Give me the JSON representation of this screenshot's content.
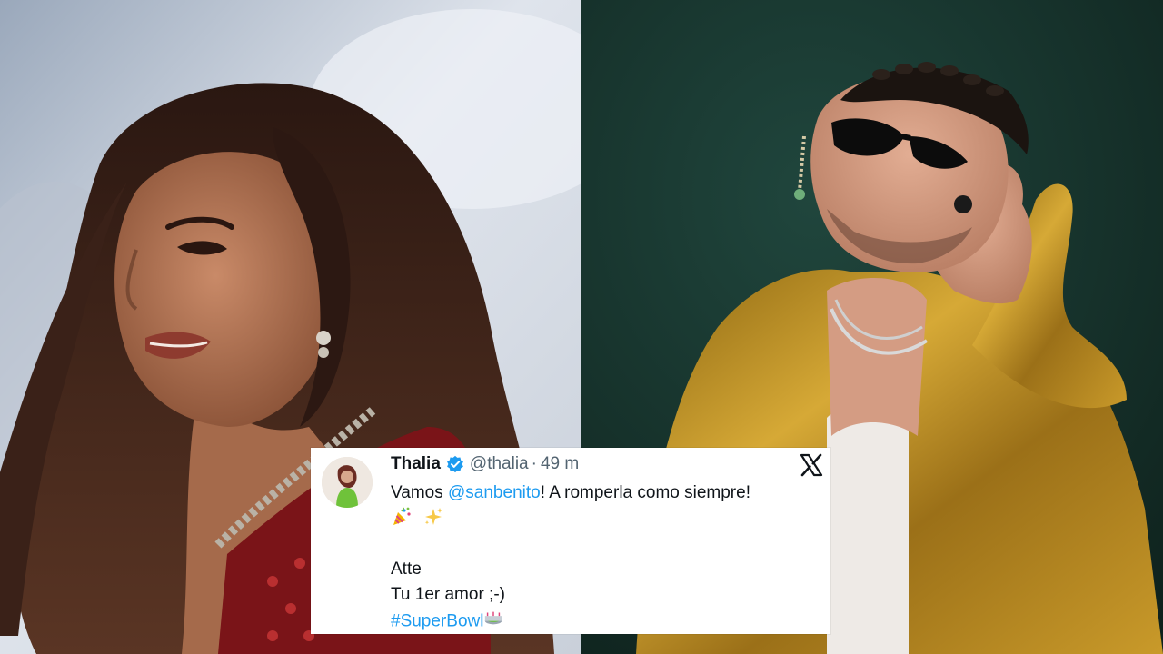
{
  "tweet": {
    "display_name": "Thalia",
    "handle": "@thalia",
    "separator": "·",
    "time": "49 m",
    "line1_prefix": "Vamos ",
    "mention": "@sanbenito",
    "line1_suffix": "!  A romperla como siempre!",
    "line3": "Atte",
    "line4": "Tu 1er amor  ;-)",
    "hashtag": "#SuperBowl",
    "emojis": [
      "party-popper",
      "sparkles",
      "stadium"
    ]
  },
  "colors": {
    "link": "#1d9bf0",
    "secondary_text": "#536471",
    "verified_badge": "#1d9bf0",
    "card_background": "#ffffff",
    "jacket_gold": "#b88a1c"
  },
  "icons": [
    "verified-badge-icon",
    "x-logo-icon"
  ]
}
